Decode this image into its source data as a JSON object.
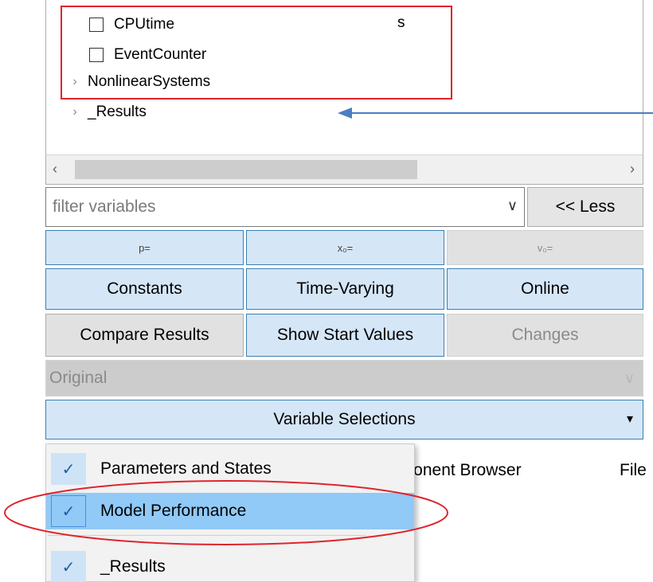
{
  "tree": {
    "items": [
      {
        "label": "CPUtime",
        "type": "checkbox",
        "unit": "s"
      },
      {
        "label": "EventCounter",
        "type": "checkbox"
      },
      {
        "label": "NonlinearSystems",
        "type": "group"
      },
      {
        "label": "_Results",
        "type": "group"
      }
    ]
  },
  "scrollbar": {
    "left_icon": "‹",
    "right_icon": "›"
  },
  "filter": {
    "placeholder": "filter variables",
    "dropdown_icon": "chevron-down-icon",
    "less_label": "<< Less"
  },
  "buttons": {
    "p_label": "p=",
    "x0_label": "x₀=",
    "v0_label": "v₀=",
    "constants": "Constants",
    "time_varying": "Time-Varying",
    "online": "Online",
    "compare_results": "Compare Results",
    "show_start_values": "Show Start Values",
    "changes": "Changes"
  },
  "original": {
    "value": "Original"
  },
  "variable_selections": {
    "label": "Variable Selections",
    "caret": "▾"
  },
  "background_tabs": {
    "component_browser": "mponent Browser",
    "file": "File"
  },
  "menu": {
    "items": [
      {
        "label": "Parameters and States",
        "checked": true
      },
      {
        "label": "Model Performance",
        "checked": true,
        "highlighted": true
      },
      {
        "label": "_Results",
        "checked": true
      }
    ]
  },
  "colors": {
    "accent_blue": "#d5e6f7",
    "border_blue": "#3c7fb1",
    "annotation_red": "#e0242c",
    "arrow_blue": "#4a7ec0"
  }
}
